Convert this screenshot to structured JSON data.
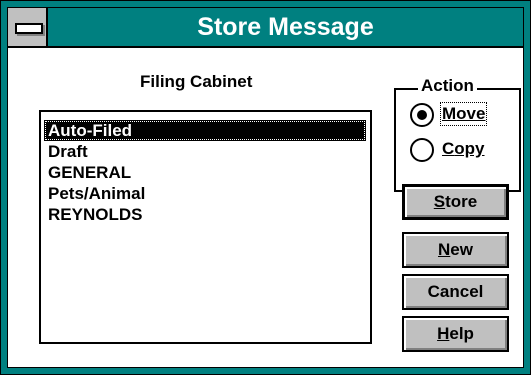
{
  "window": {
    "title": "Store Message"
  },
  "filing_cabinet": {
    "label": "Filing Cabinet",
    "items": [
      {
        "label": "Auto-Filed",
        "selected": true
      },
      {
        "label": "Draft",
        "selected": false
      },
      {
        "label": "GENERAL",
        "selected": false
      },
      {
        "label": "Pets/Animal",
        "selected": false
      },
      {
        "label": "REYNOLDS",
        "selected": false
      }
    ]
  },
  "action": {
    "title": "Action",
    "options": [
      {
        "mnemonic": "M",
        "rest": "ove",
        "selected": true
      },
      {
        "mnemonic": "C",
        "rest": "opy",
        "selected": false
      }
    ]
  },
  "buttons": [
    {
      "mnemonic": "S",
      "rest": "tore",
      "default": true
    },
    {
      "mnemonic": "N",
      "rest": "ew",
      "default": false
    },
    {
      "mnemonic": "",
      "rest": "Cancel",
      "default": false
    },
    {
      "mnemonic": "H",
      "rest": "elp",
      "default": false
    }
  ],
  "colors": {
    "titlebar": "#008080",
    "button_face": "#c0c0c0",
    "selection": "#000000"
  }
}
